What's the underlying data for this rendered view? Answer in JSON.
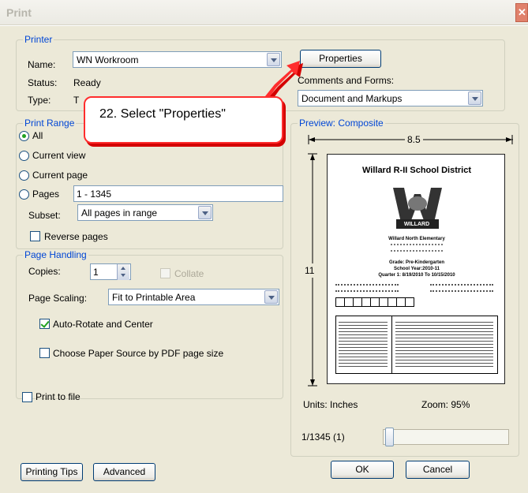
{
  "window": {
    "title": "Print",
    "close_glyph": "✕"
  },
  "printer": {
    "legend": "Printer",
    "name_label": "Name:",
    "name_value": "WN Workroom",
    "properties_label": "Properties",
    "status_label": "Status:",
    "status_value": "Ready",
    "type_label": "Type:",
    "type_value": "T",
    "comments_label": "Comments and Forms:",
    "comments_value": "Document and Markups"
  },
  "callout": {
    "text": "22.  Select \"Properties\""
  },
  "print_range": {
    "legend": "Print Range",
    "all": "All",
    "current_view": "Current view",
    "current_page": "Current page",
    "pages": "Pages",
    "pages_value": "1 - 1345",
    "subset_label": "Subset:",
    "subset_value": "All pages in range",
    "reverse": "Reverse pages"
  },
  "page_handling": {
    "legend": "Page Handling",
    "copies_label": "Copies:",
    "copies_value": "1",
    "collate": "Collate",
    "scaling_label": "Page Scaling:",
    "scaling_value": "Fit to Printable Area",
    "auto_rotate": "Auto-Rotate and Center",
    "paper_source": "Choose Paper Source by PDF page size"
  },
  "print_to_file": "Print to file",
  "preview": {
    "legend": "Preview: Composite",
    "width": "8.5",
    "height": "11",
    "units": "Units: Inches",
    "zoom": "Zoom:  95%",
    "page_counter": "1/1345 (1)",
    "doc_title": "Willard R-II School District",
    "logo_text": "WILLARD",
    "school_name": "Willard North Elementary",
    "grade": "Grade: Pre-Kindergarten",
    "school_year": "School Year:2010-11",
    "quarter": "Quarter 1: 8/19/2010 To 10/15/2010"
  },
  "footer": {
    "tips": "Printing Tips",
    "advanced": "Advanced",
    "ok": "OK",
    "cancel": "Cancel"
  }
}
